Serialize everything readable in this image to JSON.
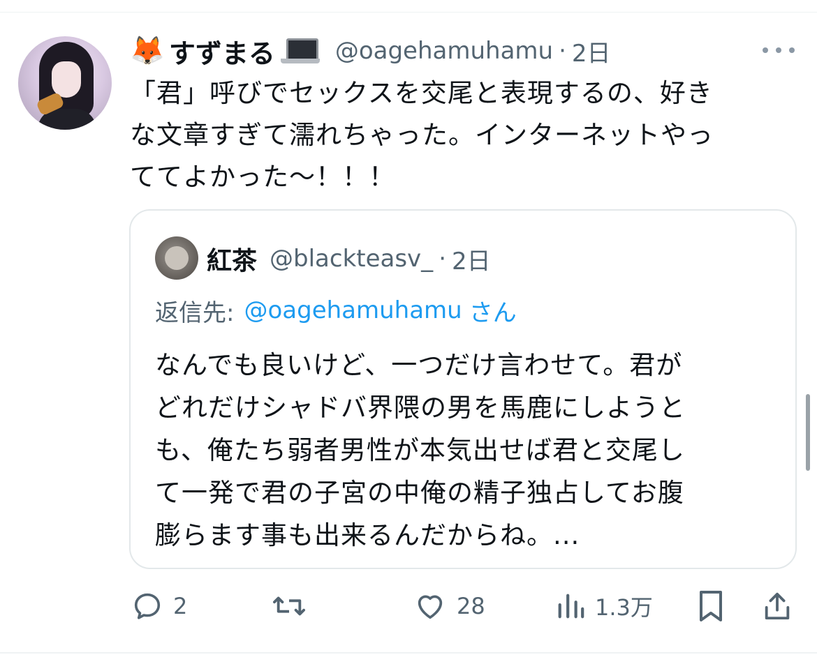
{
  "tweet": {
    "author_emoji": "🦊",
    "display_name": "すずまる",
    "handle": "@oagehamuhamu",
    "dot": "·",
    "time": "2日",
    "text_lines": [
      "「君」呼びでセックスを交尾と表現するの、好き",
      "な文章すぎて濡れちゃった。インターネットやっ",
      "ててよかった〜！！！"
    ]
  },
  "quote": {
    "display_name": "紅茶",
    "handle": "@blackteasv_",
    "dot": "·",
    "time": "2日",
    "reply_label": "返信先:",
    "reply_handle": "@oagehamuhamu",
    "reply_suffix": "さん",
    "text_lines": [
      "なんでも良いけど、一つだけ言わせて。君が",
      "どれだけシャドバ界隈の男を馬鹿にしようと",
      "も、俺たち弱者男性が本気出せば君と交尾し",
      "て一発で君の子宮の中俺の精子独占してお腹",
      "膨らます事も出来るんだからね。..."
    ]
  },
  "actions": {
    "replies": "2",
    "retweets": "",
    "likes": "28",
    "views": "1.3万"
  },
  "icons": {
    "reply": "reply-icon",
    "retweet": "retweet-icon",
    "like": "heart-icon",
    "views": "views-icon",
    "bookmark": "bookmark-icon",
    "share": "share-icon",
    "more": "more-icon",
    "laptop": "laptop-icon"
  },
  "colors": {
    "text": "#0f1419",
    "secondary": "#536471",
    "link": "#1d9bf0",
    "border": "#e3e8ea"
  }
}
